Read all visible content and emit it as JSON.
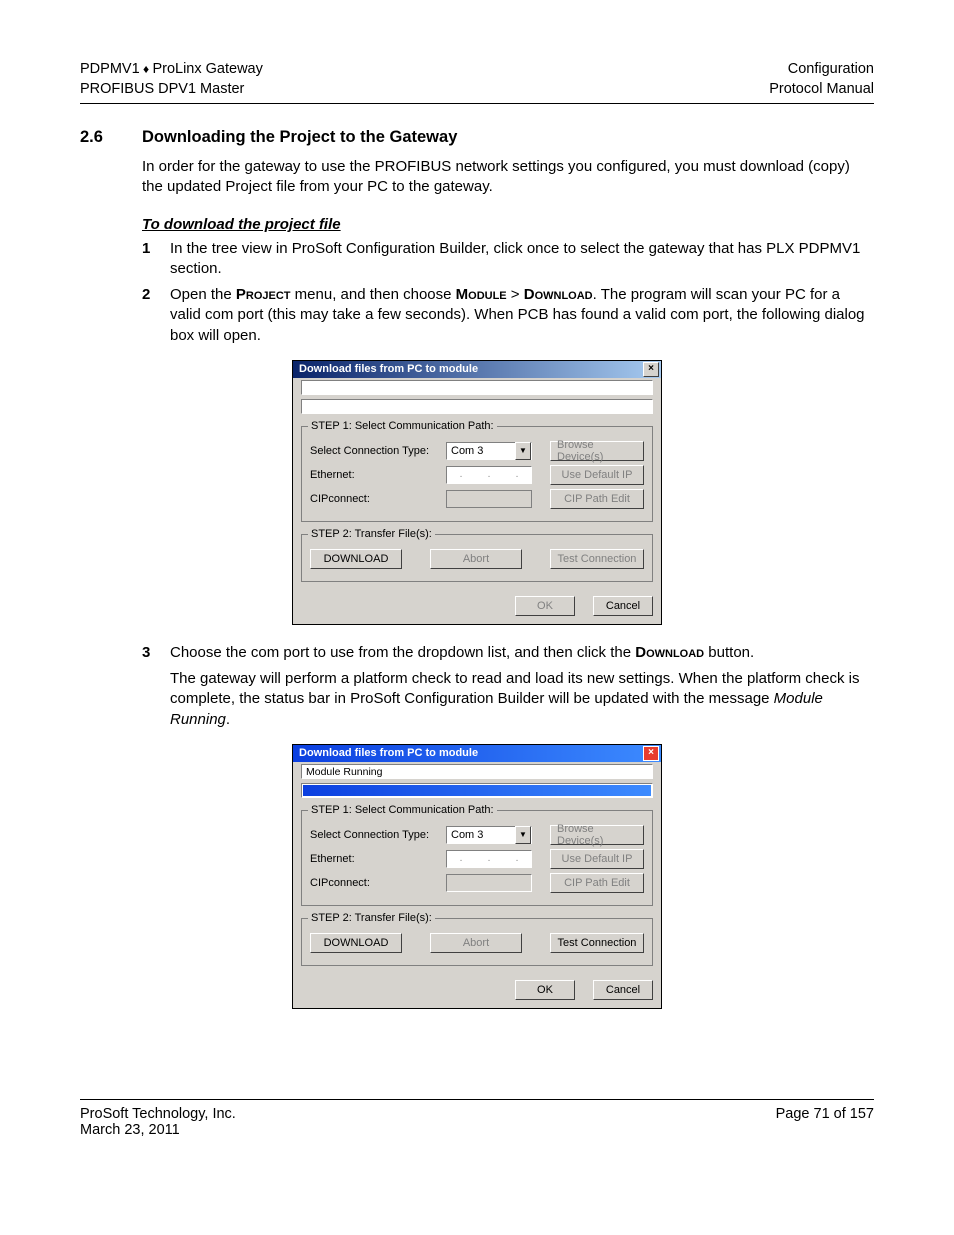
{
  "header": {
    "left1_a": "PDPMV1",
    "left1_sep": " ♦ ",
    "left1_b": "ProLinx Gateway",
    "left2": "PROFIBUS DPV1 Master",
    "right1": "Configuration",
    "right2": "Protocol Manual"
  },
  "section": {
    "num": "2.6",
    "title": "Downloading the Project to the Gateway",
    "intro": "In order for the gateway to use the PROFIBUS network settings you configured, you must download (copy) the updated Project file from your PC to the gateway.",
    "subhead": "To download the project file",
    "step1": "In the tree view in ProSoft Configuration Builder, click once to select the gateway that has PLX PDPMV1 section.",
    "step2_a": "Open the ",
    "step2_proj": "Project",
    "step2_b": " menu, and then choose ",
    "step2_mod": "Module",
    "step2_gt": " > ",
    "step2_dl": "Download",
    "step2_c": ". The program will scan your PC for a valid com port (this may take a few seconds). When PCB has found a valid com port, the following dialog box will open.",
    "step3_a": "Choose the com port to use from the dropdown list, and then click the ",
    "step3_dl": "Download",
    "step3_b": " button.",
    "post3_a": "The gateway will perform a platform check to read and load its new settings. When the platform check is complete, the status bar in ProSoft Configuration Builder will be updated with the message ",
    "post3_i": "Module Running",
    "post3_b": "."
  },
  "dialog": {
    "title": "Download files from PC to module",
    "status_running": "Module Running",
    "step1_legend": "STEP 1: Select Communication Path:",
    "step2_legend": "STEP 2: Transfer File(s):",
    "label_conn": "Select Connection Type:",
    "label_eth": "Ethernet:",
    "label_cip": "CIPconnect:",
    "combo_value": "Com 3",
    "btn_browse": "Browse Device(s)",
    "btn_useip": "Use Default IP",
    "btn_cipedit": "CIP Path Edit",
    "btn_download": "DOWNLOAD",
    "btn_abort": "Abort",
    "btn_test": "Test Connection",
    "btn_ok": "OK",
    "btn_cancel": "Cancel"
  },
  "footer": {
    "left1": "ProSoft Technology, Inc.",
    "left2": "March 23, 2011",
    "right1": "Page 71 of 157"
  }
}
